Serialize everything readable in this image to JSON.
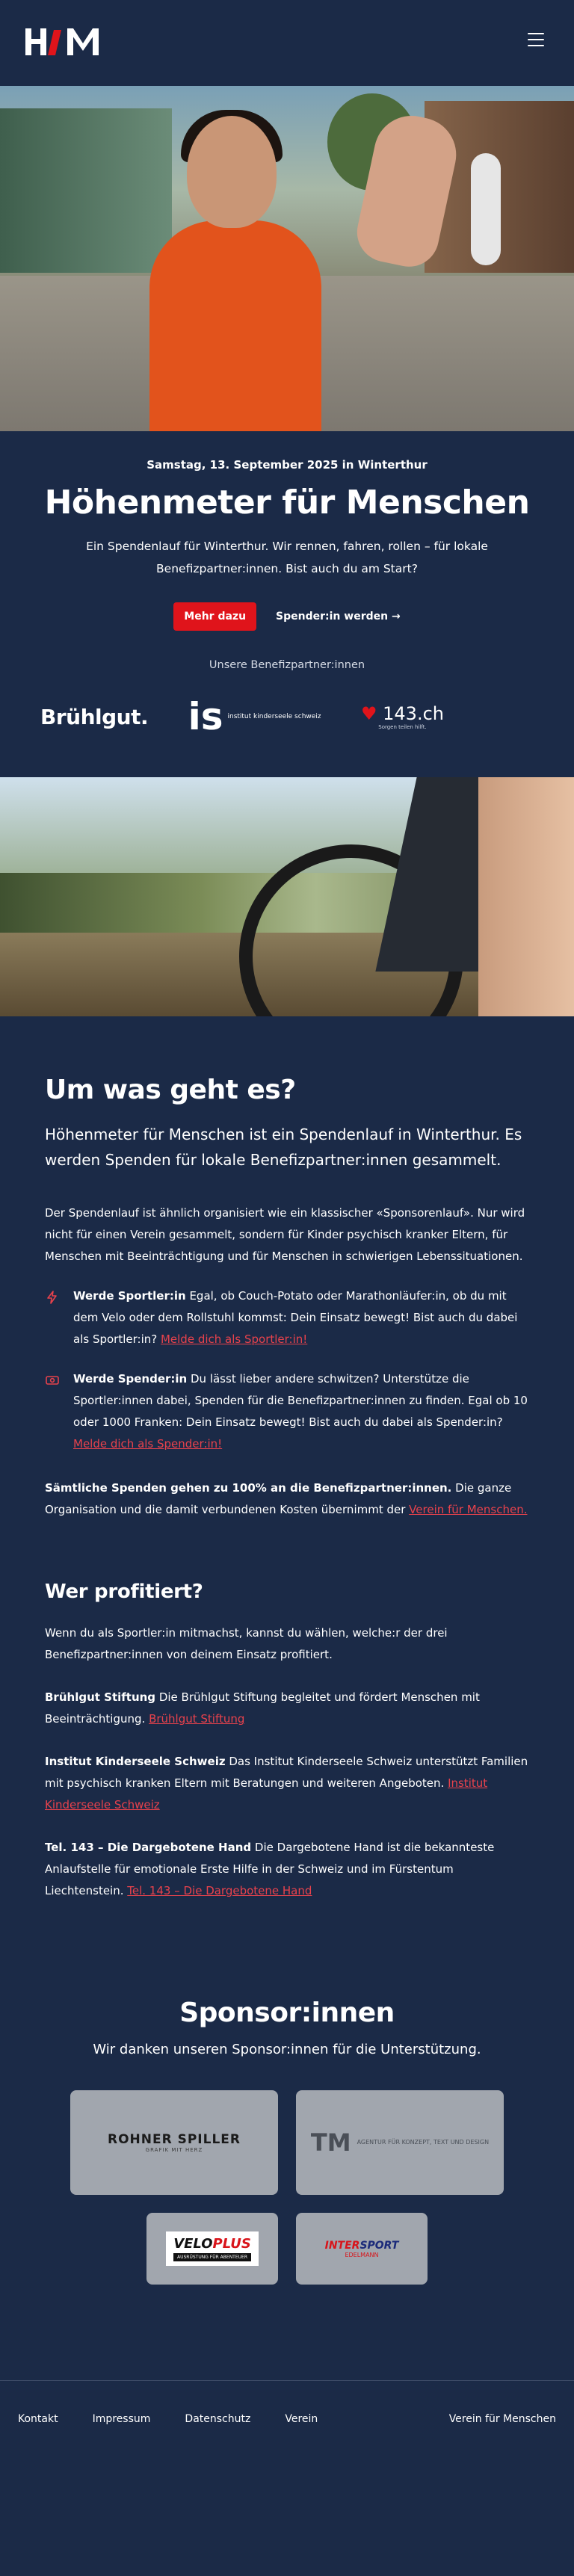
{
  "header": {
    "logo_text": "HfM",
    "menu_icon": "hamburger-icon"
  },
  "hero": {
    "date": "Samstag, 13. September 2025 in Winterthur",
    "title": "Höhenmeter für Menschen",
    "lead": "Ein Spendenlauf für Winterthur. Wir rennen, fahren, rollen – für lokale Benefizpartner:innen. Bist auch du am Start?",
    "cta_primary": "Mehr dazu",
    "cta_secondary": "Spender:in werden →",
    "partners_label": "Unsere Benefizpartner:innen",
    "partners": {
      "bruehlgut": "Brühlgut.",
      "kinderseele_mark": "is",
      "kinderseele_text": "institut kinderseele schweiz",
      "dargebotene_num": "143.ch",
      "dargebotene_tag": "Sorgen teilen hilft."
    }
  },
  "about": {
    "title": "Um was geht es?",
    "subtitle": "Höhenmeter für Menschen ist ein Spendenlauf in Winterthur. Es werden Spenden für lokale Benefizpartner:innen gesammelt.",
    "paragraph": "Der Spendenlauf ist ähnlich organisiert wie ein klassischer «Sponsorenlauf». Nur wird nicht für einen Verein gesammelt, sondern für Kinder psychisch kranker Eltern, für Menschen mit Beeinträchtigung und für Menschen in schwierigen Lebenssituationen.",
    "features": [
      {
        "icon": "lightning-icon",
        "bold": "Werde Sportler:in",
        "text": " Egal, ob Couch-Potato oder Marathonläufer:in, ob du mit dem Velo oder dem Rollstuhl kommst: Dein Einsatz bewegt! Bist auch du dabei als Sportler:in? ",
        "link": "Melde dich als Sportler:in!"
      },
      {
        "icon": "money-icon",
        "bold": "Werde Spender:in",
        "text": " Du lässt lieber andere schwitzen? Unterstütze die Sportler:innen dabei, Spenden für die Benefizpartner:innen zu finden. Egal ob 10 oder 1000 Franken: Dein Einsatz bewegt! Bist auch du dabei als Spender:in? ",
        "link": "Melde dich als Spender:in!"
      }
    ],
    "donation_bold": "Sämtliche Spenden gehen zu 100% an die Benefizpartner:innen.",
    "donation_text": " Die ganze Organisation und die damit verbundenen Kosten übernimmt der ",
    "donation_link": "Verein für Menschen."
  },
  "profit": {
    "title": "Wer profitiert?",
    "intro": "Wenn du als Sportler:in mitmachst, kannst du wählen, welche:r der drei Benefizpartner:innen von deinem Einsatz profitiert.",
    "items": [
      {
        "bold": "Brühlgut Stiftung",
        "text": " Die Brühlgut Stiftung begleitet und fördert Menschen mit Beeinträchtigung. ",
        "link": "Brühlgut Stiftung"
      },
      {
        "bold": "Institut Kinderseele Schweiz",
        "text": " Das Institut Kinderseele Schweiz unterstützt Familien mit psychisch kranken Eltern mit Beratungen und weiteren Angeboten. ",
        "link": "Institut Kinderseele Schweiz"
      },
      {
        "bold": "Tel. 143 – Die Dargebotene Hand",
        "text": " Die Dargebotene Hand ist die bekannteste Anlaufstelle für emotionale Erste Hilfe in der Schweiz und im Fürstentum Liechtenstein. ",
        "link": "Tel. 143 – Die Dargebotene Hand"
      }
    ]
  },
  "sponsors": {
    "title": "Sponsor:innen",
    "subtitle": "Wir danken unseren Sponsor:innen für die Unterstützung.",
    "rohner_name": "ROHNER SPILLER",
    "rohner_tag": "GRAFIK MIT HERZ",
    "tm_mark": "TM",
    "tm_text": "AGENTUR FÜR KONZEPT, TEXT UND DESIGN",
    "veloplus_a": "VELO",
    "veloplus_b": "PLUS",
    "veloplus_tag": "AUSRÜSTUNG FÜR ABENTEUER",
    "intersport_a": "INTER",
    "intersport_b": "SPORT",
    "intersport_tag": "EDELMANN"
  },
  "footer": {
    "links": [
      "Kontakt",
      "Impressum",
      "Datenschutz",
      "Verein"
    ],
    "right": "Verein für Menschen"
  },
  "colors": {
    "background": "#1b2a47",
    "accent": "#e0141b",
    "link": "#e8424c",
    "card": "#a1a6ae"
  }
}
